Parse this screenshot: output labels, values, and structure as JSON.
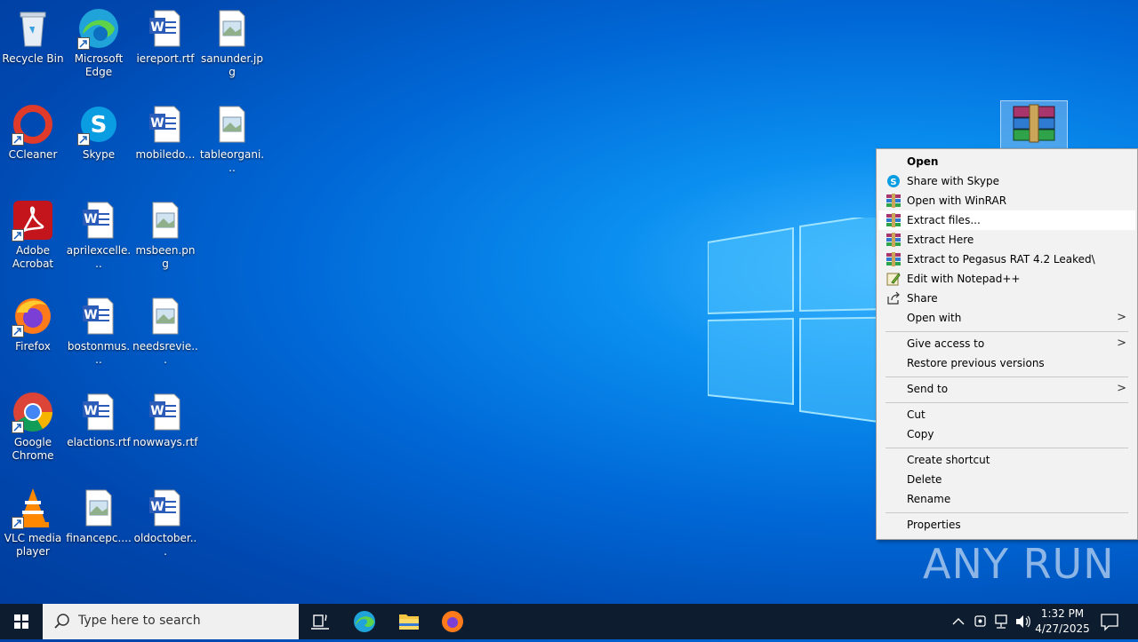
{
  "desktop": {
    "icons": [
      {
        "label": "Recycle Bin"
      },
      {
        "label": "Microsoft Edge"
      },
      {
        "label": "iereport.rtf"
      },
      {
        "label": "sanunder.jpg"
      },
      {
        "label": "CCleaner"
      },
      {
        "label": "Skype"
      },
      {
        "label": "mobiledo..."
      },
      {
        "label": "tableorgani..."
      },
      {
        "label": "Adobe Acrobat"
      },
      {
        "label": "aprilexcelle..."
      },
      {
        "label": "msbeen.png"
      },
      {
        "label": "Firefox"
      },
      {
        "label": "bostonmus..."
      },
      {
        "label": "needsrevie..."
      },
      {
        "label": "Google Chrome"
      },
      {
        "label": "elactions.rtf"
      },
      {
        "label": "nowways.rtf"
      },
      {
        "label": "VLC media player"
      },
      {
        "label": "financepc...."
      },
      {
        "label": "oldoctober..."
      }
    ]
  },
  "context_menu": {
    "items": [
      {
        "label": "Open"
      },
      {
        "label": "Share with Skype"
      },
      {
        "label": "Open with WinRAR"
      },
      {
        "label": "Extract files..."
      },
      {
        "label": "Extract Here"
      },
      {
        "label": "Extract to Pegasus RAT 4.2 Leaked\\"
      },
      {
        "label": "Edit with Notepad++"
      },
      {
        "label": "Share"
      },
      {
        "label": "Open with"
      },
      {
        "label": "Give access to"
      },
      {
        "label": "Restore previous versions"
      },
      {
        "label": "Send to"
      },
      {
        "label": "Cut"
      },
      {
        "label": "Copy"
      },
      {
        "label": "Create shortcut"
      },
      {
        "label": "Delete"
      },
      {
        "label": "Rename"
      },
      {
        "label": "Properties"
      }
    ],
    "submenu_arrow": ">"
  },
  "taskbar": {
    "search_placeholder": "Type here to search",
    "time": "1:32 PM",
    "date": "4/27/2025"
  },
  "watermark": "ANY RUN",
  "colors": {
    "desktop_blue": "#0068d6",
    "taskbar": "#0d1c2e",
    "menu_bg": "#f2f2f2"
  }
}
